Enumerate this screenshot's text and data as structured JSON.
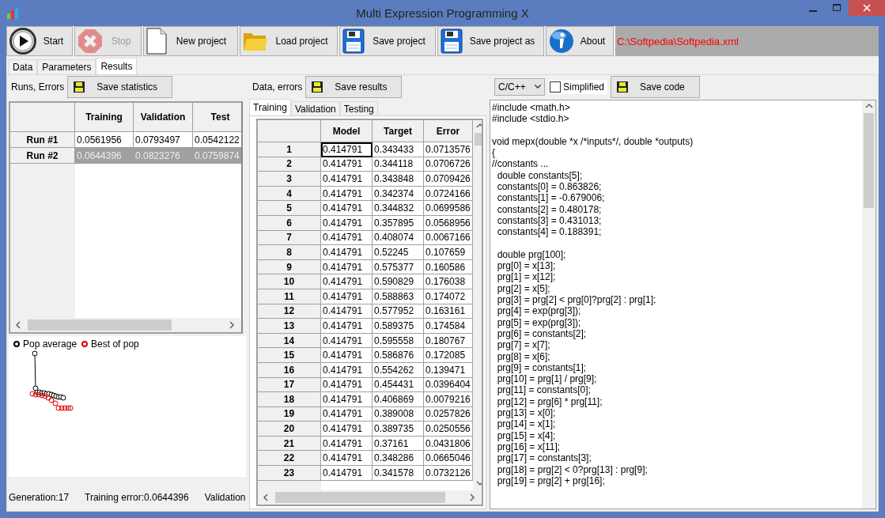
{
  "window": {
    "title": "Multi Expression Programming X"
  },
  "toolbar": [
    {
      "label": "Start",
      "kind": "play",
      "disabled": false
    },
    {
      "label": "Stop",
      "kind": "stop",
      "disabled": true
    },
    {
      "label": "New project",
      "kind": "new",
      "disabled": false
    },
    {
      "label": "Load project",
      "kind": "open",
      "disabled": false
    },
    {
      "label": "Save project",
      "kind": "save",
      "disabled": false
    },
    {
      "label": "Save project as",
      "kind": "save",
      "disabled": false
    },
    {
      "label": "About",
      "kind": "info",
      "disabled": false
    }
  ],
  "project_path": "C:\\Softpedia\\Softpedia.xml",
  "tabs": [
    {
      "label": "Data",
      "selected": false
    },
    {
      "label": "Parameters",
      "selected": false
    },
    {
      "label": "Results",
      "selected": true
    }
  ],
  "runs": {
    "label": "Runs, Errors",
    "save_button": "Save statistics",
    "columns": [
      "Training",
      "Validation",
      "Test"
    ],
    "rows": [
      {
        "header": "Run #1",
        "cells": [
          "0.0561956",
          "0.0793497",
          "0.0542122"
        ],
        "selected": false
      },
      {
        "header": "Run #2",
        "cells": [
          "0.0644396",
          "0.0823276",
          "0.0759874"
        ],
        "selected": true
      }
    ]
  },
  "chart_legend": [
    {
      "label": "Pop average",
      "color": "#000000"
    },
    {
      "label": "Best of pop",
      "color": "#e00000"
    }
  ],
  "status": [
    "Generation:17",
    "Training error:0.0644396",
    "Validation"
  ],
  "data": {
    "label": "Data, errors",
    "save_button": "Save results",
    "tabs": [
      {
        "label": "Training",
        "selected": true
      },
      {
        "label": "Validation",
        "selected": false
      },
      {
        "label": "Testing",
        "selected": false
      }
    ],
    "columns": [
      "Model",
      "Target",
      "Error"
    ],
    "rows": [
      {
        "header": "1",
        "cells": [
          "0.414791",
          "0.343433",
          "0.0713576"
        ]
      },
      {
        "header": "2",
        "cells": [
          "0.414791",
          "0.344118",
          "0.0706726"
        ]
      },
      {
        "header": "3",
        "cells": [
          "0.414791",
          "0.343848",
          "0.0709426"
        ]
      },
      {
        "header": "4",
        "cells": [
          "0.414791",
          "0.342374",
          "0.0724166"
        ]
      },
      {
        "header": "5",
        "cells": [
          "0.414791",
          "0.344832",
          "0.0699586"
        ]
      },
      {
        "header": "6",
        "cells": [
          "0.414791",
          "0.357895",
          "0.0568956"
        ]
      },
      {
        "header": "7",
        "cells": [
          "0.414791",
          "0.408074",
          "0.0067166"
        ]
      },
      {
        "header": "8",
        "cells": [
          "0.414791",
          "0.52245",
          "0.107659"
        ]
      },
      {
        "header": "9",
        "cells": [
          "0.414791",
          "0.575377",
          "0.160586"
        ]
      },
      {
        "header": "10",
        "cells": [
          "0.414791",
          "0.590829",
          "0.176038"
        ]
      },
      {
        "header": "11",
        "cells": [
          "0.414791",
          "0.588863",
          "0.174072"
        ]
      },
      {
        "header": "12",
        "cells": [
          "0.414791",
          "0.577952",
          "0.163161"
        ]
      },
      {
        "header": "13",
        "cells": [
          "0.414791",
          "0.589375",
          "0.174584"
        ]
      },
      {
        "header": "14",
        "cells": [
          "0.414791",
          "0.595558",
          "0.180767"
        ]
      },
      {
        "header": "15",
        "cells": [
          "0.414791",
          "0.586876",
          "0.172085"
        ]
      },
      {
        "header": "16",
        "cells": [
          "0.414791",
          "0.554262",
          "0.139471"
        ]
      },
      {
        "header": "17",
        "cells": [
          "0.414791",
          "0.454431",
          "0.0396404"
        ]
      },
      {
        "header": "18",
        "cells": [
          "0.414791",
          "0.406869",
          "0.0079216"
        ]
      },
      {
        "header": "19",
        "cells": [
          "0.414791",
          "0.389008",
          "0.0257826"
        ]
      },
      {
        "header": "20",
        "cells": [
          "0.414791",
          "0.389735",
          "0.0250556"
        ]
      },
      {
        "header": "21",
        "cells": [
          "0.414791",
          "0.37161",
          "0.0431806"
        ]
      },
      {
        "header": "22",
        "cells": [
          "0.414791",
          "0.348286",
          "0.0665046"
        ]
      },
      {
        "header": "23",
        "cells": [
          "0.414791",
          "0.341578",
          "0.0732126"
        ]
      }
    ]
  },
  "code": {
    "language": "C/C++",
    "simplified": false,
    "simplified_label": "Simplified",
    "save_button": "Save code",
    "blocks": [
      [
        "#include <math.h>",
        "#include <stdio.h>"
      ],
      [
        "void mepx(double *x /*inputs*/, double *outputs)",
        "{",
        "//constants ...",
        "  double constants[5];",
        "  constants[0] = 0.863826;",
        "  constants[1] = -0.679006;",
        "  constants[2] = 0.480178;",
        "  constants[3] = 0.431013;",
        "  constants[4] = 0.188391;"
      ],
      [
        "  double prg[100];",
        "  prg[0] = x[13];",
        "  prg[1] = x[12];",
        "  prg[2] = x[5];",
        "  prg[3] = prg[2] < prg[0]?prg[2] : prg[1];",
        "  prg[4] = exp(prg[3]);",
        "  prg[5] = exp(prg[3]);",
        "  prg[6] = constants[2];",
        "  prg[7] = x[7];",
        "  prg[8] = x[6];",
        "  prg[9] = constants[1];",
        "  prg[10] = prg[1] / prg[9];",
        "  prg[11] = constants[0];",
        "  prg[12] = prg[6] * prg[11];",
        "  prg[13] = x[0];",
        "  prg[14] = x[1];",
        "  prg[15] = x[4];",
        "  prg[16] = x[11];",
        "  prg[17] = constants[3];",
        "  prg[18] = prg[2] < 0?prg[13] : prg[9];",
        "  prg[19] = prg[2] + prg[16];"
      ]
    ]
  }
}
